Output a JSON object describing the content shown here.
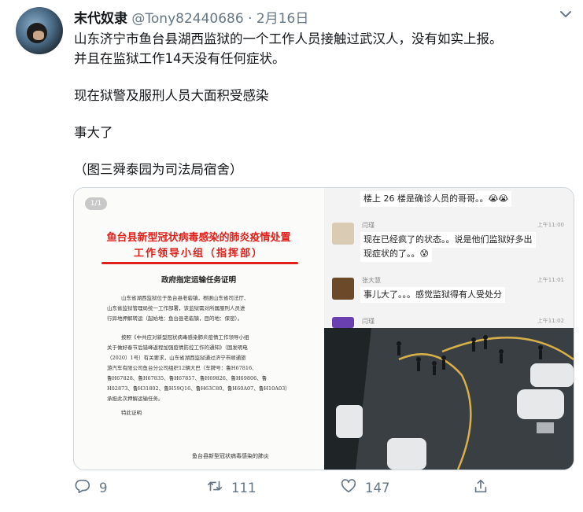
{
  "tweet": {
    "display_name": "末代奴隶",
    "handle": "@Tony82440686",
    "separator": "·",
    "date": "2月16日",
    "lines": [
      "山东济宁市鱼台县湖西监狱的一个工作人员接触过武汉人，没有如实上报。",
      "并且在监狱工作14天没有任何症状。",
      "现在狱警及服刑人员大面积受感染",
      "事大了",
      "（图三舜泰园为司法局宿舍）"
    ]
  },
  "document_image": {
    "page_badge": "1/1",
    "title_line1": "鱼台县新型冠状病毒感染的肺炎疫情处置",
    "title_line2": "工作领导小组（指挥部）",
    "subtitle": "政府指定运输任务证明",
    "paragraphs": [
      "山东省湖西监狱位于鱼台县老砦镇，根据山东省司法厅、",
      "山东省监狱管理局统一工作部署，该监狱需对所属服刑人员进",
      "行异地押解转运（起始地：鱼台县老砦镇，目的地：保密）。",
      "按照《中共应对新型冠状病毒感染肺炎疫情工作领导小组",
      "关于做好春节后错峰返程加强疫情防控工作的通知》（国发明电",
      "（2020）1号）有关要求，山东省湖西监狱通过济宁市顺通旅",
      "游汽车有限公司鱼台分公司组织12辆大巴（车牌号：鲁H67816、",
      "鲁H67828、鲁H67835、鲁H67857、鲁H69826、鲁H69806、鲁",
      "H02873、鲁H31802、鲁H59Q16、鲁H63C80、鲁H60A07、鲁H10A03）",
      "承担此次押解运输任务。",
      "特此证明"
    ],
    "signature": "鱼台县新型冠状病毒感染的肺炎"
  },
  "chat_image": {
    "messages": [
      {
        "text": "楼上 26 楼是确诊人员的哥哥。。😭😭"
      },
      {
        "name": "闫瑾",
        "time": "上午11:00",
        "text": "现在已经疯了的状态。。说是他们监狱好多出",
        "text2": "现症状的了。。😰"
      },
      {
        "name": "张大慧",
        "time": "上午11:01",
        "text": "事儿大了。。。感觉监狱得有人受处分"
      },
      {
        "name": "闫瑾",
        "time": "上午11:02"
      }
    ]
  },
  "actions": {
    "reply_count": "9",
    "retweet_count": "111",
    "like_count": "147"
  },
  "colors": {
    "secondary_text": "#657786",
    "document_red": "#e0201b",
    "border": "#ccd6dd"
  }
}
